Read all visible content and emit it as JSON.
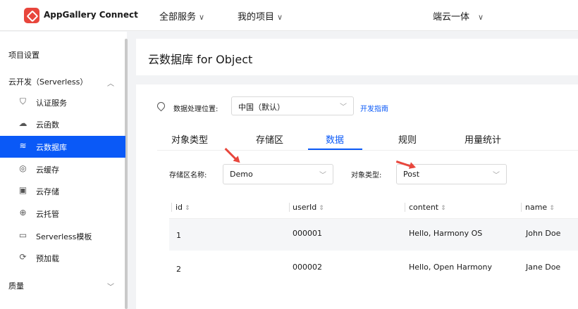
{
  "header": {
    "brand": "AppGallery Connect",
    "nav": [
      {
        "label": "全部服务"
      },
      {
        "label": "我的项目"
      },
      {
        "label": "端云一体"
      }
    ]
  },
  "sidebar": {
    "section_settings": "项目设置",
    "group_serverless": "云开发（Serverless）",
    "items": [
      {
        "label": "认证服务",
        "icon": "shield-check-icon"
      },
      {
        "label": "云函数",
        "icon": "cloud-function-icon"
      },
      {
        "label": "云数据库",
        "icon": "database-icon",
        "active": true
      },
      {
        "label": "云缓存",
        "icon": "cache-icon"
      },
      {
        "label": "云存储",
        "icon": "image-storage-icon"
      },
      {
        "label": "云托管",
        "icon": "globe-hosting-icon"
      },
      {
        "label": "Serverless模板",
        "icon": "template-icon"
      },
      {
        "label": "预加载",
        "icon": "preload-icon"
      }
    ],
    "group_quality": "质量"
  },
  "page": {
    "title": "云数据库 for Object"
  },
  "location": {
    "label": "数据处理位置:",
    "value": "中国（默认）",
    "guide_link": "开发指南"
  },
  "tabs": [
    {
      "label": "对象类型"
    },
    {
      "label": "存储区"
    },
    {
      "label": "数据",
      "active": true
    },
    {
      "label": "规则"
    },
    {
      "label": "用量统计"
    }
  ],
  "filters": {
    "zone_label": "存储区名称:",
    "zone_value": "Demo",
    "type_label": "对象类型:",
    "type_value": "Post"
  },
  "table": {
    "columns": [
      "id",
      "userId",
      "content",
      "name"
    ],
    "rows": [
      {
        "id": "1",
        "userId": "000001",
        "content": "Hello, Harmony OS",
        "name": "John Doe"
      },
      {
        "id": "2",
        "userId": "000002",
        "content": "Hello, Open Harmony",
        "name": "Jane Doe"
      }
    ]
  },
  "colors": {
    "accent": "#0a59f7",
    "brand": "#e8463c",
    "annotation_arrow": "#e8463c"
  }
}
